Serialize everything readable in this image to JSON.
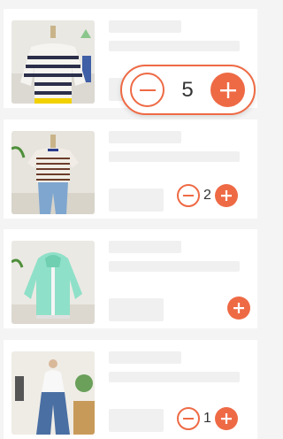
{
  "accent_color": "#ee6a45",
  "items": [
    {
      "thumbnail": "striped-sweater-photo",
      "quantity": "5",
      "has_quantity": true,
      "highlighted": true
    },
    {
      "thumbnail": "striped-tshirt-jeans-photo",
      "quantity": "2",
      "has_quantity": true,
      "highlighted": false
    },
    {
      "thumbnail": "mint-hoodie-photo",
      "quantity": "",
      "has_quantity": false,
      "highlighted": false
    },
    {
      "thumbnail": "white-top-jeans-photo",
      "quantity": "1",
      "has_quantity": true,
      "highlighted": false
    }
  ],
  "icons": {
    "minus": "minus-circle-icon",
    "plus": "plus-circle-icon"
  }
}
